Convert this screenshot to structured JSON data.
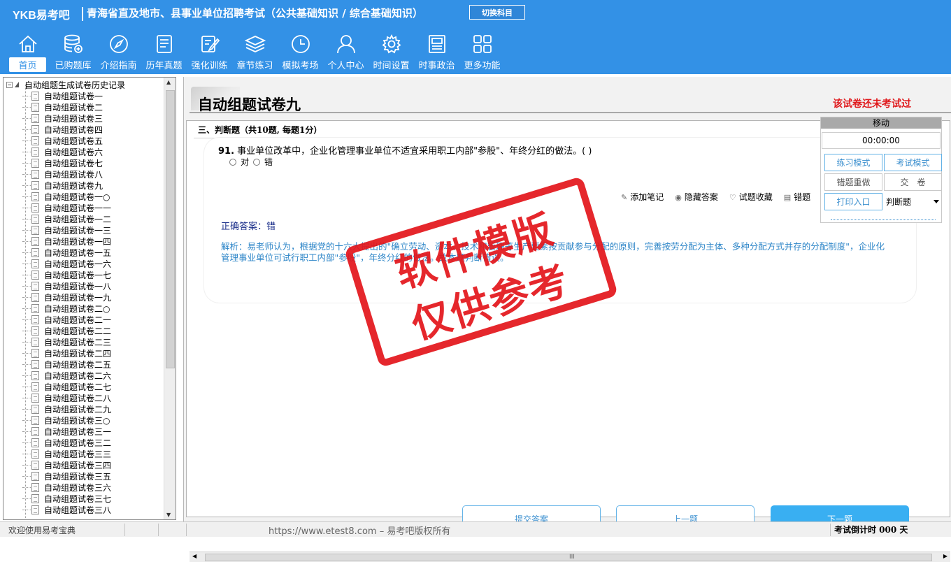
{
  "header": {
    "brand": "YKB易考吧",
    "title": "青海省直及地市、县事业单位招聘考试（公共基础知识 / 综合基础知识）",
    "switch_label": "切换科目"
  },
  "nav": [
    {
      "label": "首页",
      "icon": "home-icon",
      "active": true
    },
    {
      "label": "已购题库",
      "icon": "database-icon"
    },
    {
      "label": "介绍指南",
      "icon": "compass-icon"
    },
    {
      "label": "历年真题",
      "icon": "list-icon"
    },
    {
      "label": "强化训练",
      "icon": "edit-icon"
    },
    {
      "label": "章节练习",
      "icon": "layers-icon"
    },
    {
      "label": "模拟考场",
      "icon": "clock-icon"
    },
    {
      "label": "个人中心",
      "icon": "user-icon"
    },
    {
      "label": "时间设置",
      "icon": "gear-icon"
    },
    {
      "label": "时事政治",
      "icon": "news-icon"
    },
    {
      "label": "更多功能",
      "icon": "grid-icon"
    }
  ],
  "tree": {
    "root": "自动组题生成试卷历史记录",
    "items": [
      "自动组题试卷一",
      "自动组题试卷二",
      "自动组题试卷三",
      "自动组题试卷四",
      "自动组题试卷五",
      "自动组题试卷六",
      "自动组题试卷七",
      "自动组题试卷八",
      "自动组题试卷九",
      "自动组题试卷一○",
      "自动组题试卷一一",
      "自动组题试卷一二",
      "自动组题试卷一三",
      "自动组题试卷一四",
      "自动组题试卷一五",
      "自动组题试卷一六",
      "自动组题试卷一七",
      "自动组题试卷一八",
      "自动组题试卷一九",
      "自动组题试卷二○",
      "自动组题试卷二一",
      "自动组题试卷二二",
      "自动组题试卷二三",
      "自动组题试卷二四",
      "自动组题试卷二五",
      "自动组题试卷二六",
      "自动组题试卷二七",
      "自动组题试卷二八",
      "自动组题试卷二九",
      "自动组题试卷三○",
      "自动组题试卷三一",
      "自动组题试卷三二",
      "自动组题试卷三三",
      "自动组题试卷三四",
      "自动组题试卷三五",
      "自动组题试卷三六",
      "自动组题试卷三七",
      "自动组题试卷三八"
    ]
  },
  "paper": {
    "title": "自动组题试卷九",
    "status": "该试卷还未考试过",
    "section": "三、判断题（共10题, 每题1分）",
    "question_no": "91.",
    "question": "事业单位改革中，企业化管理事业单位不适宜采用职工内部\"参股\"、年终分红的做法。( )",
    "options": [
      "对",
      "错"
    ],
    "tools": [
      {
        "label": "添加笔记",
        "icon": "pencil-icon"
      },
      {
        "label": "隐藏答案",
        "icon": "eye-icon"
      },
      {
        "label": "试题收藏",
        "icon": "heart-icon"
      },
      {
        "label": "错题",
        "icon": "book-icon"
      }
    ],
    "answer": "正确答案：错",
    "analysis": "解析：易老师认为，根据党的十六大提出的\"确立劳动、资本、技术和管理等生产要素按贡献参与分配的原则，完善按劳分配为主体、多种分配方式并存的分配制度\"，企业化管理事业单位可试行职工内部\"参股\"，年终分红的做法。故本题判断错误。"
  },
  "stamp": {
    "line1": "软件模版",
    "line2": "仅供参考",
    "color": "#e3151b"
  },
  "buttons": {
    "submit": "提交答案",
    "prev": "上一题",
    "next": "下一题"
  },
  "float_panel": {
    "move": "移动",
    "timer": "00:00:00",
    "practice": "练习模式",
    "exam": "考试模式",
    "redo": "错题重做",
    "hand_in": "交　卷",
    "print": "打印入口",
    "type_select": "判断题"
  },
  "status_bar": {
    "welcome": "欢迎使用易考宝典",
    "site": "https://www.etest8.com – 易考吧版权所有",
    "countdown": "考试倒计时 000 天"
  },
  "colors": {
    "header_bg": "#3391e6",
    "accent": "#39aff2",
    "alert": "#e0191c"
  }
}
